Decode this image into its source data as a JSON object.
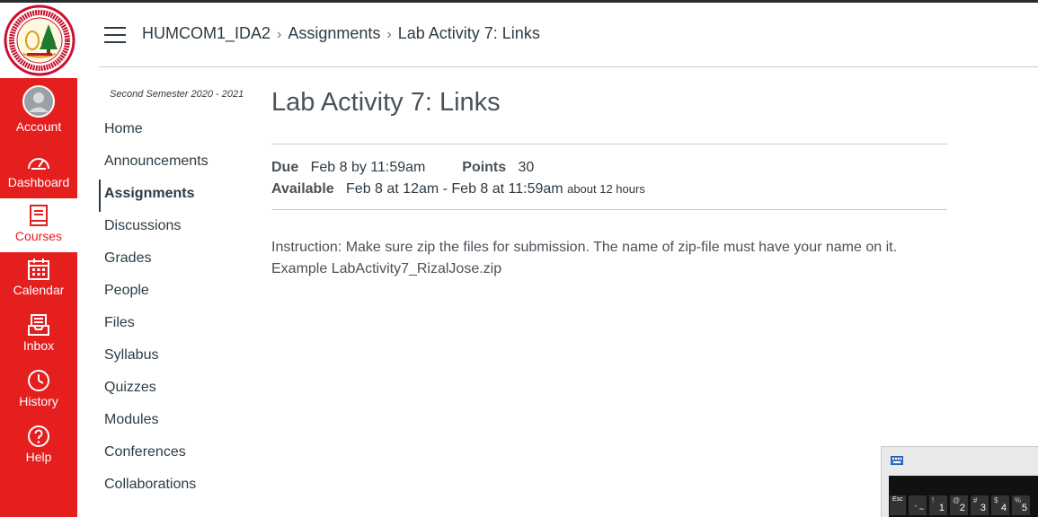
{
  "global_nav": {
    "items": [
      {
        "label": "Account",
        "icon": "account-avatar-icon"
      },
      {
        "label": "Dashboard",
        "icon": "dashboard-gauge-icon"
      },
      {
        "label": "Courses",
        "icon": "book-icon",
        "active": true
      },
      {
        "label": "Calendar",
        "icon": "calendar-icon"
      },
      {
        "label": "Inbox",
        "icon": "inbox-icon"
      },
      {
        "label": "History",
        "icon": "clock-icon"
      },
      {
        "label": "Help",
        "icon": "help-circle-icon"
      }
    ],
    "colors": {
      "background": "#e51e1e",
      "active_background": "#ffffff",
      "active_text": "#e51e1e"
    }
  },
  "breadcrumb": {
    "course": "HUMCOM1_IDA2",
    "section": "Assignments",
    "page": "Lab Activity 7: Links"
  },
  "course_nav": {
    "term": "Second Semester 2020 - 2021",
    "items": [
      "Home",
      "Announcements",
      "Assignments",
      "Discussions",
      "Grades",
      "People",
      "Files",
      "Syllabus",
      "Quizzes",
      "Modules",
      "Conferences",
      "Collaborations"
    ],
    "active": "Assignments"
  },
  "assignment": {
    "title": "Lab Activity 7: Links",
    "due_label": "Due",
    "due_value": "Feb 8 by 11:59am",
    "points_label": "Points",
    "points_value": "30",
    "available_label": "Available",
    "available_value": "Feb 8 at 12am - Feb 8 at 11:59am",
    "available_note": "about 12 hours",
    "instruction": "Instruction: Make sure zip the files for submission. The name of zip-file must have your name on it. Example LabActivity7_RizalJose.zip"
  },
  "keyboard": {
    "keys": [
      {
        "main": "Esc",
        "sub": ""
      },
      {
        "main": "` ~",
        "sub": ""
      },
      {
        "main": "1",
        "sub": "!"
      },
      {
        "main": "2",
        "sub": "@"
      },
      {
        "main": "3",
        "sub": "#"
      },
      {
        "main": "4",
        "sub": "$"
      },
      {
        "main": "5",
        "sub": "%"
      }
    ]
  }
}
